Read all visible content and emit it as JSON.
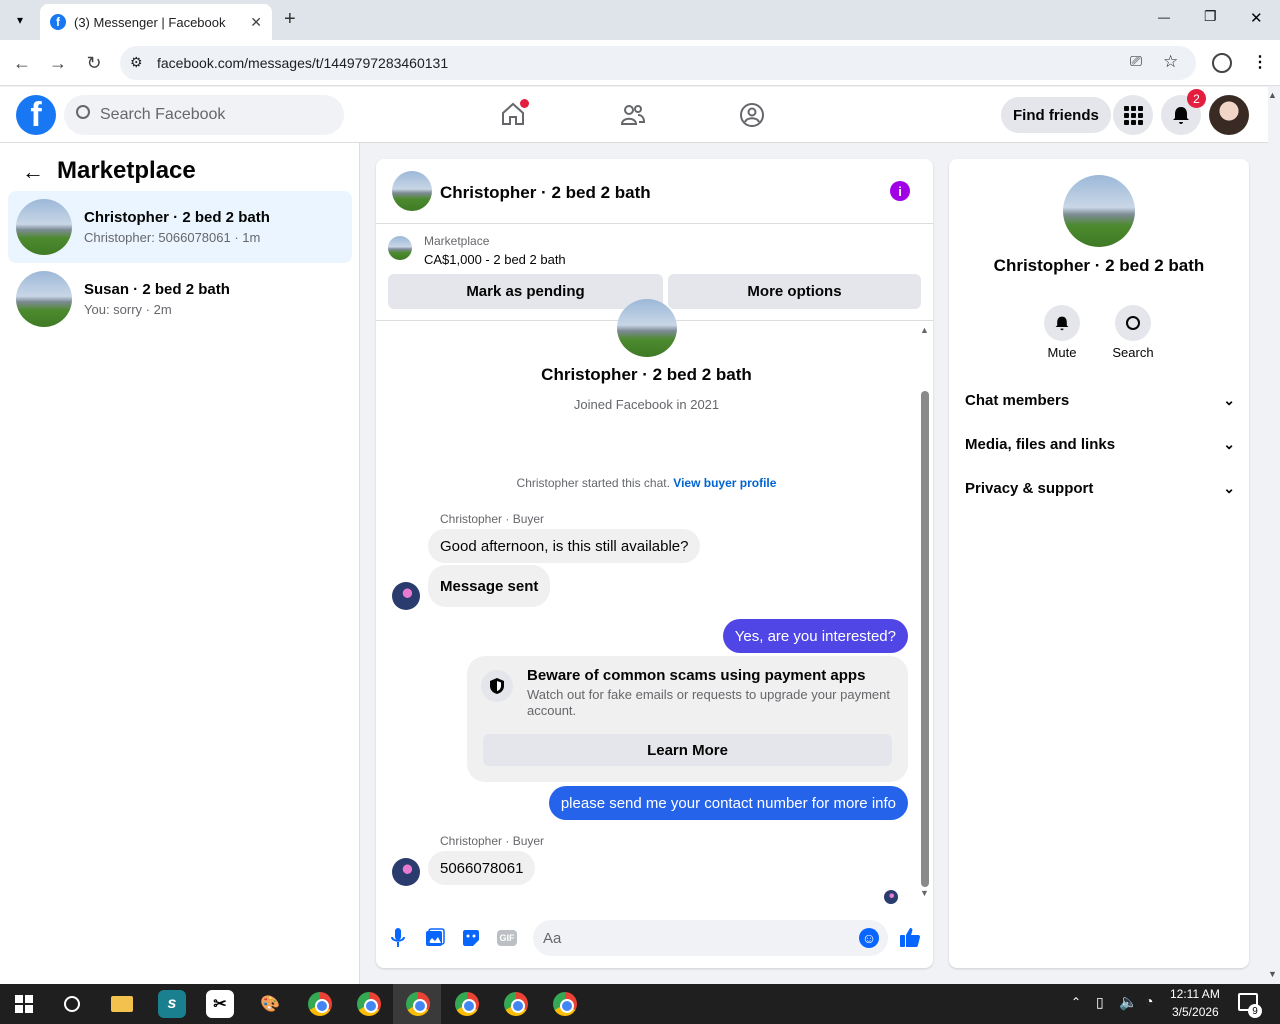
{
  "browser": {
    "tab_title": "(3) Messenger | Facebook",
    "tab_close": "✕",
    "new_tab": "+",
    "url": "facebook.com/messages/t/1449797283460131",
    "window_min": "—",
    "window_restore": "❐",
    "window_close": "✕"
  },
  "fb": {
    "logo": "f",
    "search_placeholder": "Search Facebook",
    "find_friends": "Find friends",
    "notifications_count": "2"
  },
  "left": {
    "title": "Marketplace",
    "conversations": [
      {
        "name": "Christopher · 2 bed 2 bath",
        "preview": "Christopher: 5066078061 · 1m"
      },
      {
        "name": "Susan · 2 bed 2 bath",
        "preview": "You: sorry · 2m"
      }
    ]
  },
  "chat": {
    "header_name": "Christopher · 2 bed 2 bath",
    "listing_label": "Marketplace",
    "listing_price": "CA$1,000 - 2 bed 2 bath",
    "mark_pending": "Mark as pending",
    "more_options": "More options",
    "profile_name": "Christopher · 2 bed 2 bath",
    "joined": "Joined Facebook in 2021",
    "started_text": "Christopher started this chat.",
    "view_profile": "View buyer profile",
    "sender_label": "Christopher · Buyer",
    "msg1": "Good afternoon, is this still available?",
    "msg2": "Message sent",
    "msg3": "Yes, are you interested?",
    "scam_title": "Beware of common scams using payment apps",
    "scam_body": "Watch out for fake emails or requests to upgrade your payment account.",
    "learn_more": "Learn More",
    "msg4": "please send me  your contact number for more info",
    "sender_label2": "Christopher · Buyer",
    "msg5": "5066078061",
    "input_placeholder": "Aa",
    "gif_label": "GIF"
  },
  "right": {
    "name": "Christopher · 2 bed 2 bath",
    "mute": "Mute",
    "search": "Search",
    "sections": [
      "Chat members",
      "Media, files and links",
      "Privacy & support"
    ]
  },
  "taskbar": {
    "time": "12:11 AM",
    "date": "3/5/2026",
    "notif_count": "9"
  },
  "colors": {
    "brand": "#1877f2",
    "outgoing": "#4f46e5",
    "info": "#a100e6"
  }
}
